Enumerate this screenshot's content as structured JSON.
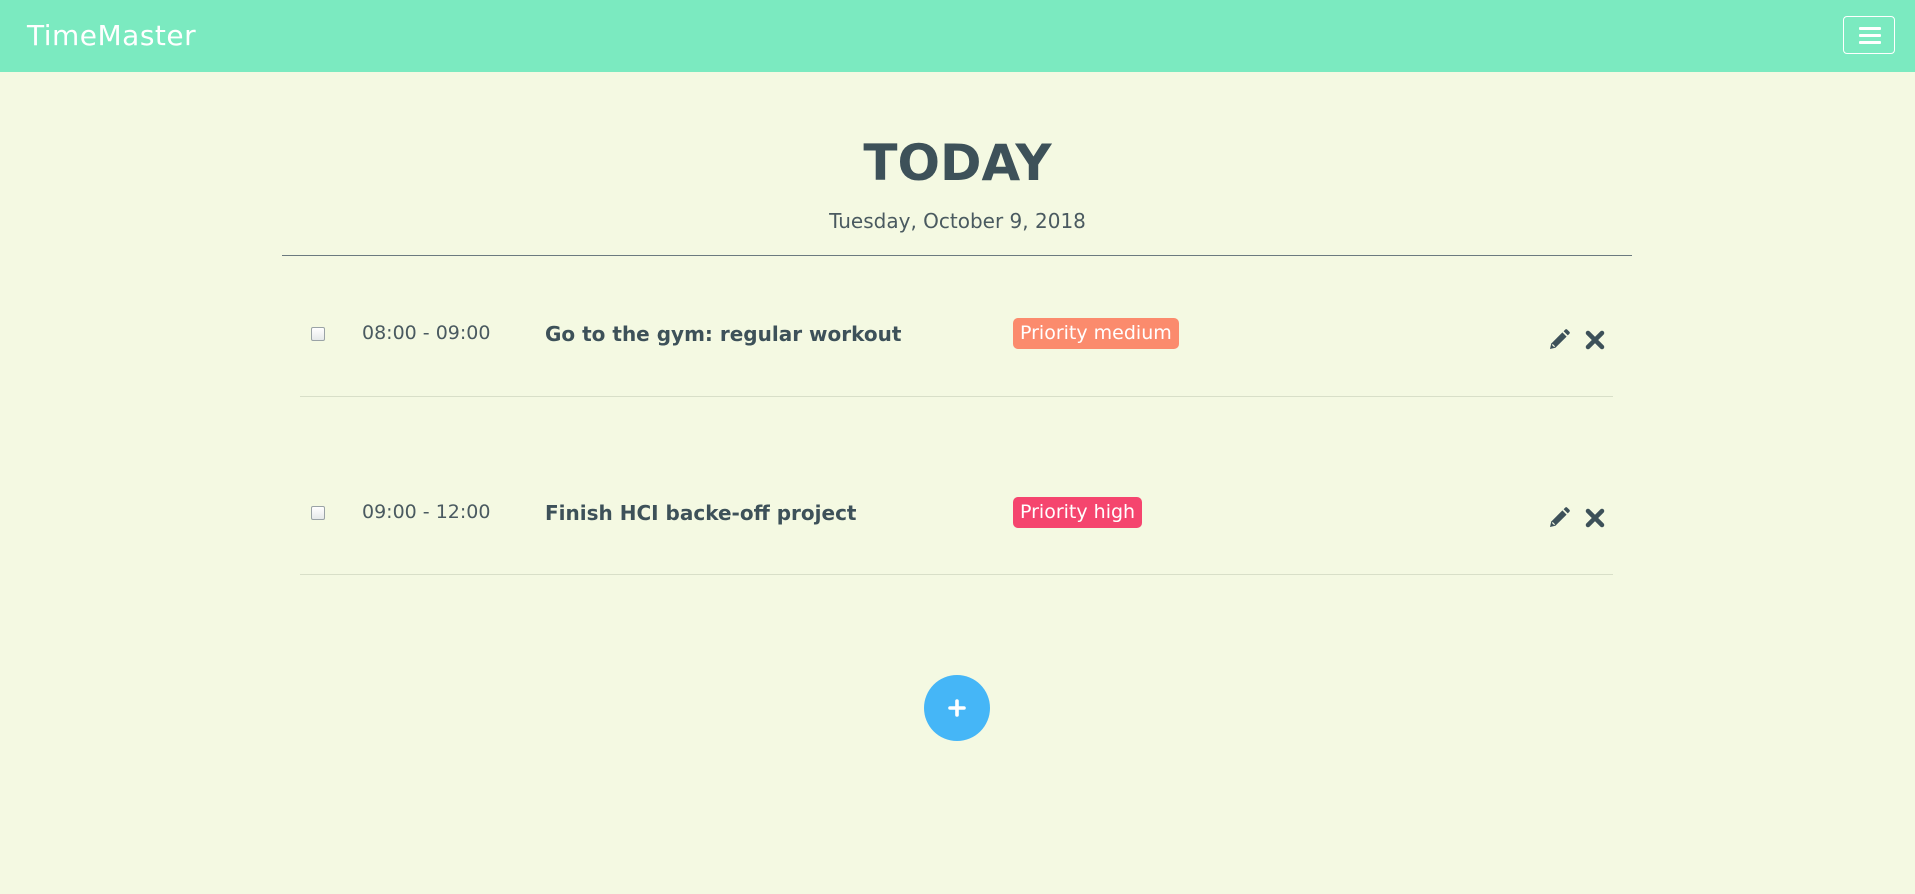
{
  "navbar": {
    "brand": "TimeMaster",
    "menu_icon": "hamburger-menu-icon",
    "background": "#7beac0"
  },
  "header": {
    "title": "TODAY",
    "date": "Tuesday, October 9, 2018"
  },
  "tasks": [
    {
      "time": "08:00 - 09:00",
      "name": "Go to the gym: regular workout",
      "priority_label": "Priority medium",
      "priority_color": "#fb8b6d",
      "checked": false,
      "edit_icon": "pencil-icon",
      "delete_icon": "close-icon"
    },
    {
      "time": "09:00 - 12:00",
      "name": "Finish HCI backe-off project",
      "priority_label": "Priority high",
      "priority_color": "#f5456e",
      "checked": false,
      "edit_icon": "pencil-icon",
      "delete_icon": "close-icon"
    }
  ],
  "add_button": {
    "icon": "plus-icon",
    "color": "#45b6f7"
  },
  "colors": {
    "page_background": "#f4f9e2",
    "text": "#3d5159"
  }
}
